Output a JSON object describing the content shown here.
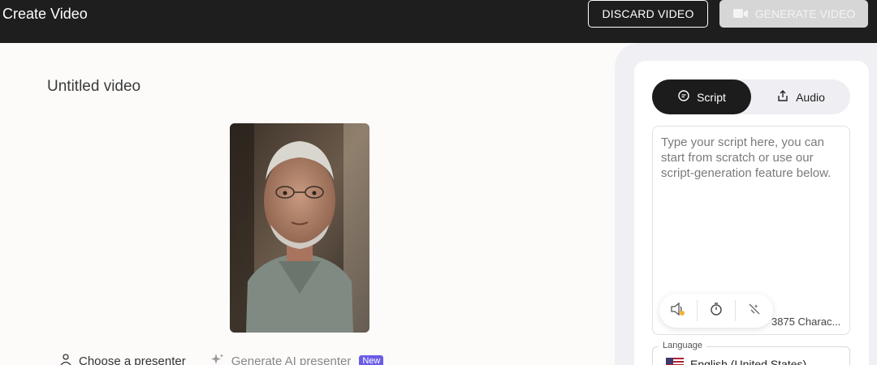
{
  "header": {
    "title": "Create Video",
    "discard_label": "DISCARD VIDEO",
    "generate_label": "GENERATE VIDEO"
  },
  "main": {
    "video_title": "Untitled video",
    "choose_presenter_label": "Choose a presenter",
    "generate_ai_label": "Generate AI presenter",
    "new_badge": "New"
  },
  "panel": {
    "tabs": [
      {
        "label": "Script",
        "active": true
      },
      {
        "label": "Audio",
        "active": false
      }
    ],
    "script_placeholder": "Type your script here, you can start from scratch or use our script-generation feature below.",
    "char_count": "3875 Charac...",
    "language_label": "Language",
    "language_value": "English (United States)"
  },
  "colors": {
    "topbar": "#1e1e1e",
    "badge": "#6b5ce7",
    "active_tab": "#1c1c1c",
    "generate_disabled": "#d6d6d6"
  }
}
